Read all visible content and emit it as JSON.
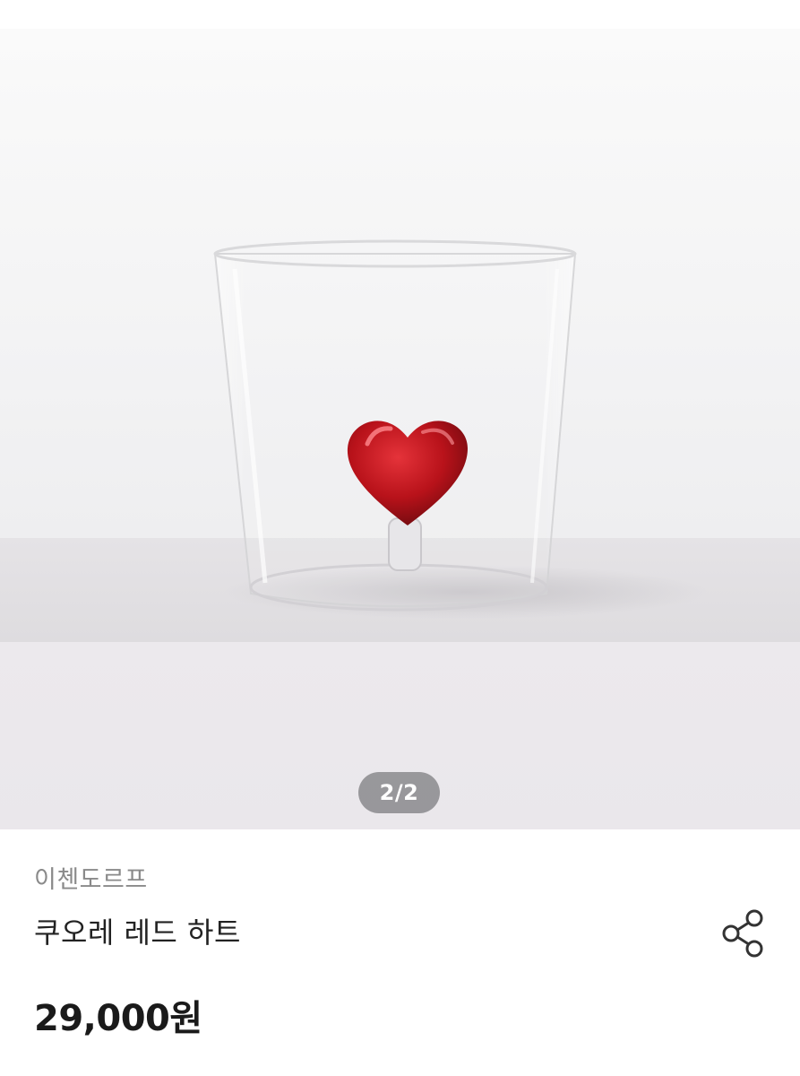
{
  "gallery": {
    "pager_text": "2/2",
    "current_page": 2,
    "total_pages": 2
  },
  "product": {
    "brand": "이첸도르프",
    "name": "쿠오레 레드 하트",
    "price": "29,000원"
  },
  "icons": {
    "share": "share-icon"
  },
  "colors": {
    "heart": "#c8141c",
    "price_text": "#1a1a1a",
    "brand_text": "#8a8a8a"
  }
}
